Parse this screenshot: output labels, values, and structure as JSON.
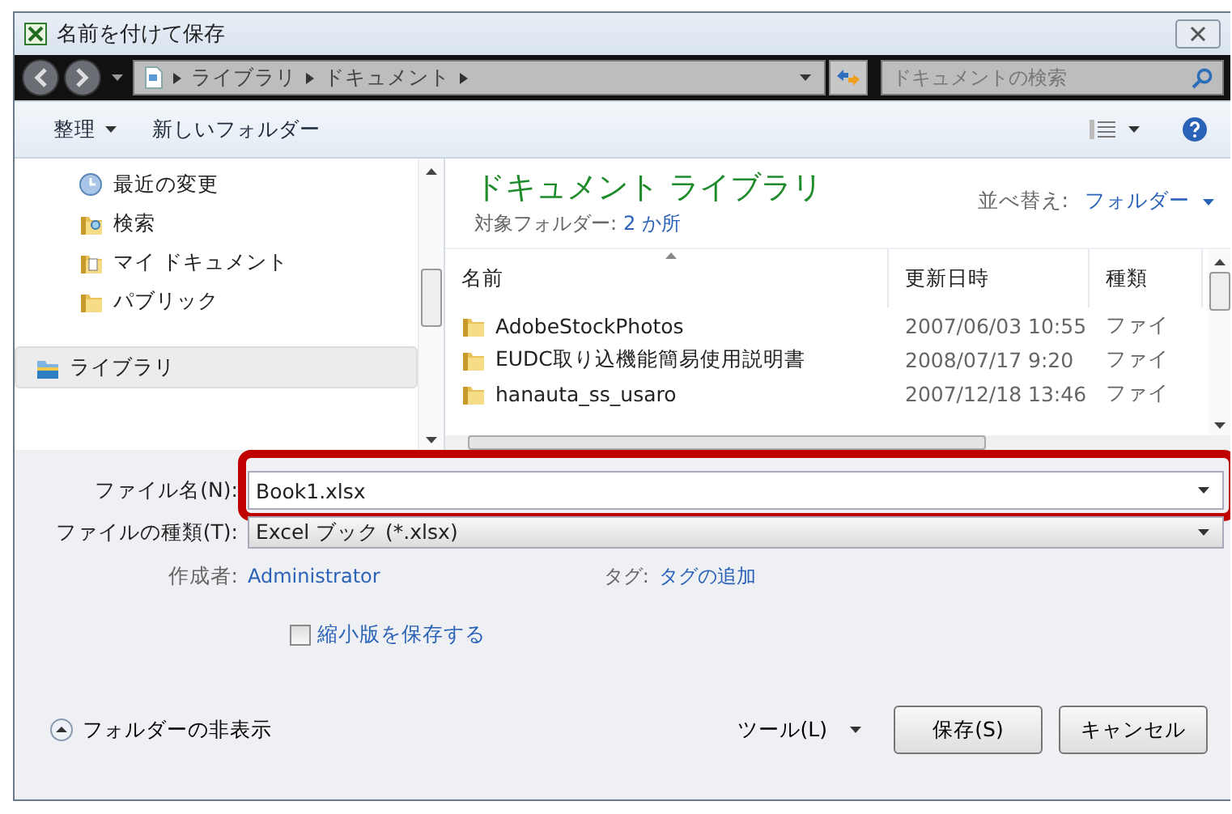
{
  "window": {
    "title": "名前を付けて保存"
  },
  "address_bar": {
    "path": [
      "ライブラリ",
      "ドキュメント"
    ],
    "search_placeholder": "ドキュメントの検索"
  },
  "toolbar": {
    "organize": "整理",
    "new_folder": "新しいフォルダー"
  },
  "nav_pane": {
    "items": [
      {
        "label": "最近の変更",
        "kind": "recent",
        "selected": false
      },
      {
        "label": "検索",
        "kind": "search",
        "selected": false
      },
      {
        "label": "マイ ドキュメント",
        "kind": "docs",
        "selected": false
      },
      {
        "label": "パブリック",
        "kind": "folder",
        "selected": false
      },
      {
        "label": "ライブラリ",
        "kind": "library",
        "selected": true
      }
    ]
  },
  "library": {
    "title": "ドキュメント ライブラリ",
    "target_label": "対象フォルダー:",
    "target_link": "2 か所",
    "sort_label": "並べ替え:",
    "sort_value": "フォルダー"
  },
  "table": {
    "columns": [
      "名前",
      "更新日時",
      "種類"
    ],
    "rows": [
      [
        "AdobeStockPhotos",
        "2007/06/03 10:55",
        "ファイ"
      ],
      [
        "EUDC取り込機能簡易使用説明書",
        "2008/07/17 9:20",
        "ファイ"
      ],
      [
        "hanauta_ss_usaro",
        "2007/12/18 13:46",
        "ファイ"
      ]
    ]
  },
  "form": {
    "file_name_label": "ファイル名(N):",
    "file_name": "Book1.xlsx",
    "file_name_highlighted": true,
    "file_type_label": "ファイルの種類(T):",
    "file_type": "Excel ブック (*.xlsx)",
    "author_label": "作成者:",
    "author": "Administrator",
    "tags_label": "タグ:",
    "tags": "タグの追加",
    "thumbnail_label": "縮小版を保存する",
    "thumbnail_checked": false
  },
  "footer": {
    "hide_folders": "フォルダーの非表示",
    "tools": "ツール(L)",
    "buttons": [
      "保存(S)",
      "キャンセル"
    ]
  }
}
